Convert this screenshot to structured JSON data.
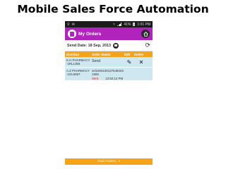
{
  "slide": {
    "title": "Mobile Sales Force Automation"
  },
  "status_bar": {
    "icons": [
      "usb-icon",
      "notification-icon",
      "wifi-icon",
      "signal-icon",
      "battery-icon"
    ],
    "battery": "41%",
    "time": "1:01 PM"
  },
  "app_bar": {
    "title": "My Orders",
    "icon": "clipboard-icon",
    "action_icon": "home-icon"
  },
  "filter": {
    "date_label": "Send Date: 18 Sep, 2013"
  },
  "table": {
    "headers": {
      "distributor": "Distribut",
      "order_status": "Order Status",
      "edit": "Edit",
      "delete": "Delete"
    },
    "rows": [
      {
        "distributor_line1": "K.H PHARMACY",
        "distributor_line2": "-1RL1355",
        "status": "Send"
      },
      {
        "distributor_line1": "A.Z PHARMACY",
        "distributor_line2": "-1OL5597",
        "order_id_line1": "sel100010013754832S",
        "order_id_line2": "1908",
        "status": "Sent",
        "time": "12:52:13 PM"
      }
    ]
  },
  "footer": {
    "total_label": "Total Orders : 2"
  },
  "colors": {
    "app_bar": "#b024bd",
    "table_header": "#f5a31a",
    "row_bg": "#cfe7f1",
    "status_sent": "#dd1111"
  }
}
